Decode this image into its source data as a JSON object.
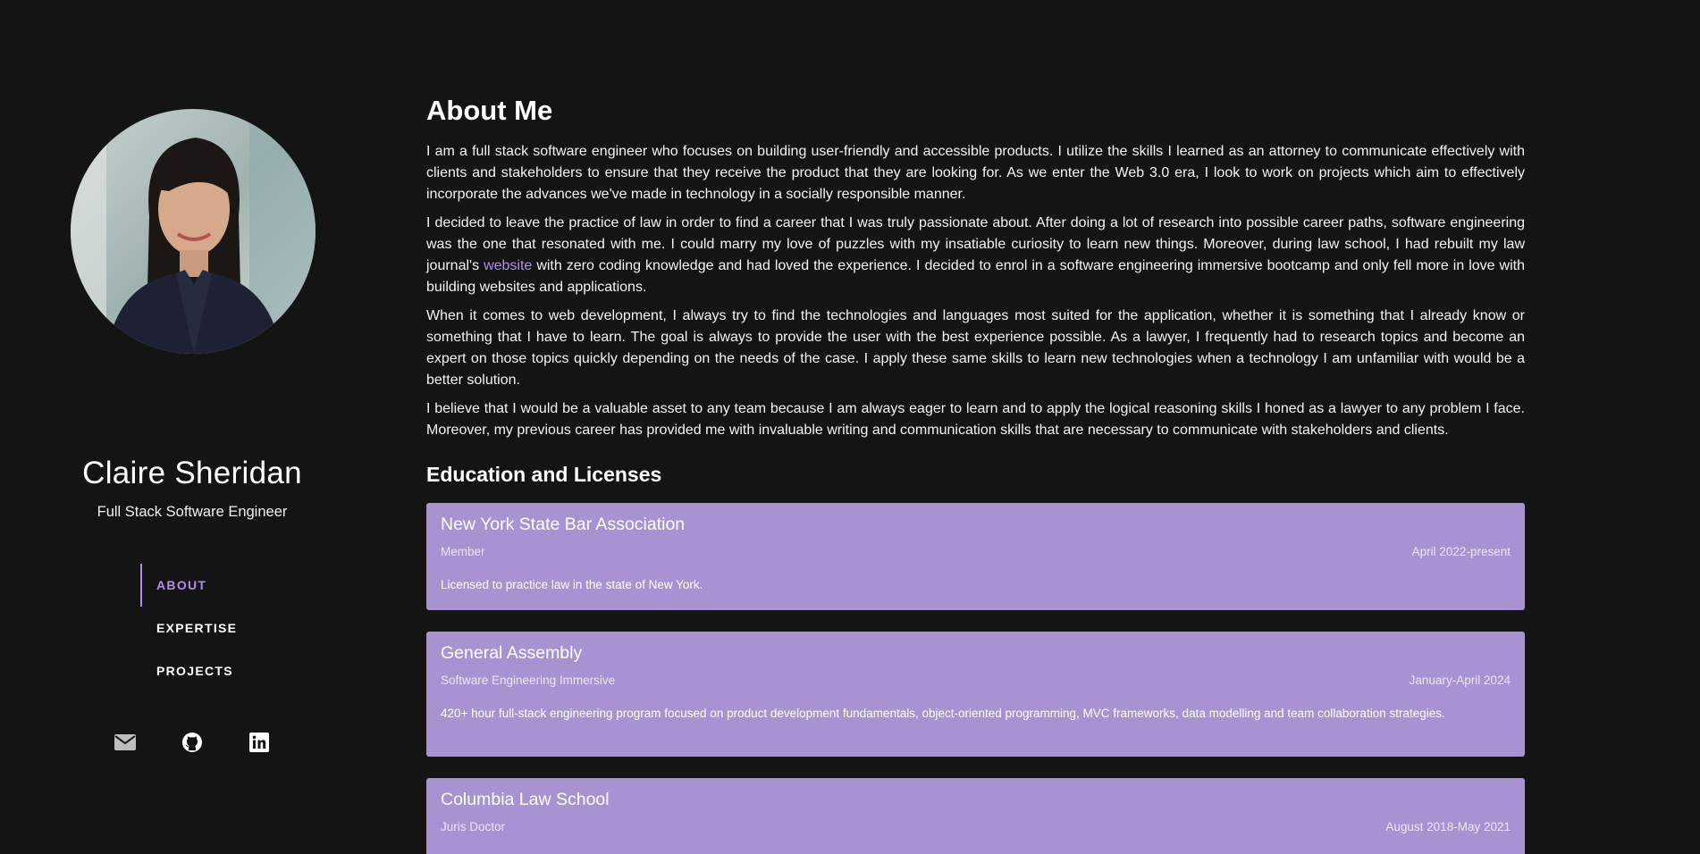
{
  "profile": {
    "name": "Claire Sheridan",
    "role": "Full Stack Software Engineer"
  },
  "nav": {
    "items": [
      {
        "label": "ABOUT",
        "active": true
      },
      {
        "label": "EXPERTISE",
        "active": false
      },
      {
        "label": "PROJECTS",
        "active": false
      }
    ]
  },
  "socials": [
    "mail-icon",
    "github-icon",
    "linkedin-icon"
  ],
  "about": {
    "title": "About Me",
    "p1": "I am a full stack software engineer who focuses on building user-friendly and accessible products. I utilize the skills I learned as an attorney to communicate effectively with clients and stakeholders to ensure that they receive the product that they are looking for. As we enter the Web 3.0 era, I look to work on projects which aim to effectively incorporate the advances we've made in technology in a socially responsible manner.",
    "p2_before": "I decided to leave the practice of law in order to find a career that I was truly passionate about. After doing a lot of research into possible career paths, software engineering was the one that resonated with me. I could marry my love of puzzles with my insatiable curiosity to learn new things. Moreover, during law school, I had rebuilt my law journal's ",
    "p2_link": "website",
    "p2_after": " with zero coding knowledge and had loved the experience. I decided to enrol in a software engineering immersive bootcamp and only fell more in love with building websites and applications.",
    "p3": "When it comes to web development, I always try to find the technologies and languages most suited for the application, whether it is something that I already know or something that I have to learn. The goal is always to provide the user with the best experience possible. As a lawyer, I frequently had to research topics and become an expert on those topics quickly depending on the needs of the case. I apply these same skills to learn new technologies when a technology I am unfamiliar with would be a better solution.",
    "p4": "I believe that I would be a valuable asset to any team because I am always eager to learn and to apply the logical reasoning skills I honed as a lawyer to any problem I face. Moreover, my previous career has provided me with invaluable writing and communication skills that are necessary to communicate with stakeholders and clients."
  },
  "education": {
    "title": "Education and Licenses",
    "cards": [
      {
        "title": "New York State Bar Association",
        "subtitle": "Member",
        "date": "April 2022-present",
        "desc": "Licensed to practice law in the state of New York."
      },
      {
        "title": "General Assembly",
        "subtitle": "Software Engineering Immersive",
        "date": "January-April 2024",
        "desc": "420+ hour full-stack engineering program focused on product development fundamentals, object-oriented programming, MVC frameworks, data modelling and team collaboration strategies."
      },
      {
        "title": "Columbia Law School",
        "subtitle": "Juris Doctor",
        "date": "August 2018-May 2021",
        "desc": ""
      }
    ]
  },
  "colors": {
    "background": "#141414",
    "accent": "#b08ef0",
    "card": "#a892d2"
  }
}
